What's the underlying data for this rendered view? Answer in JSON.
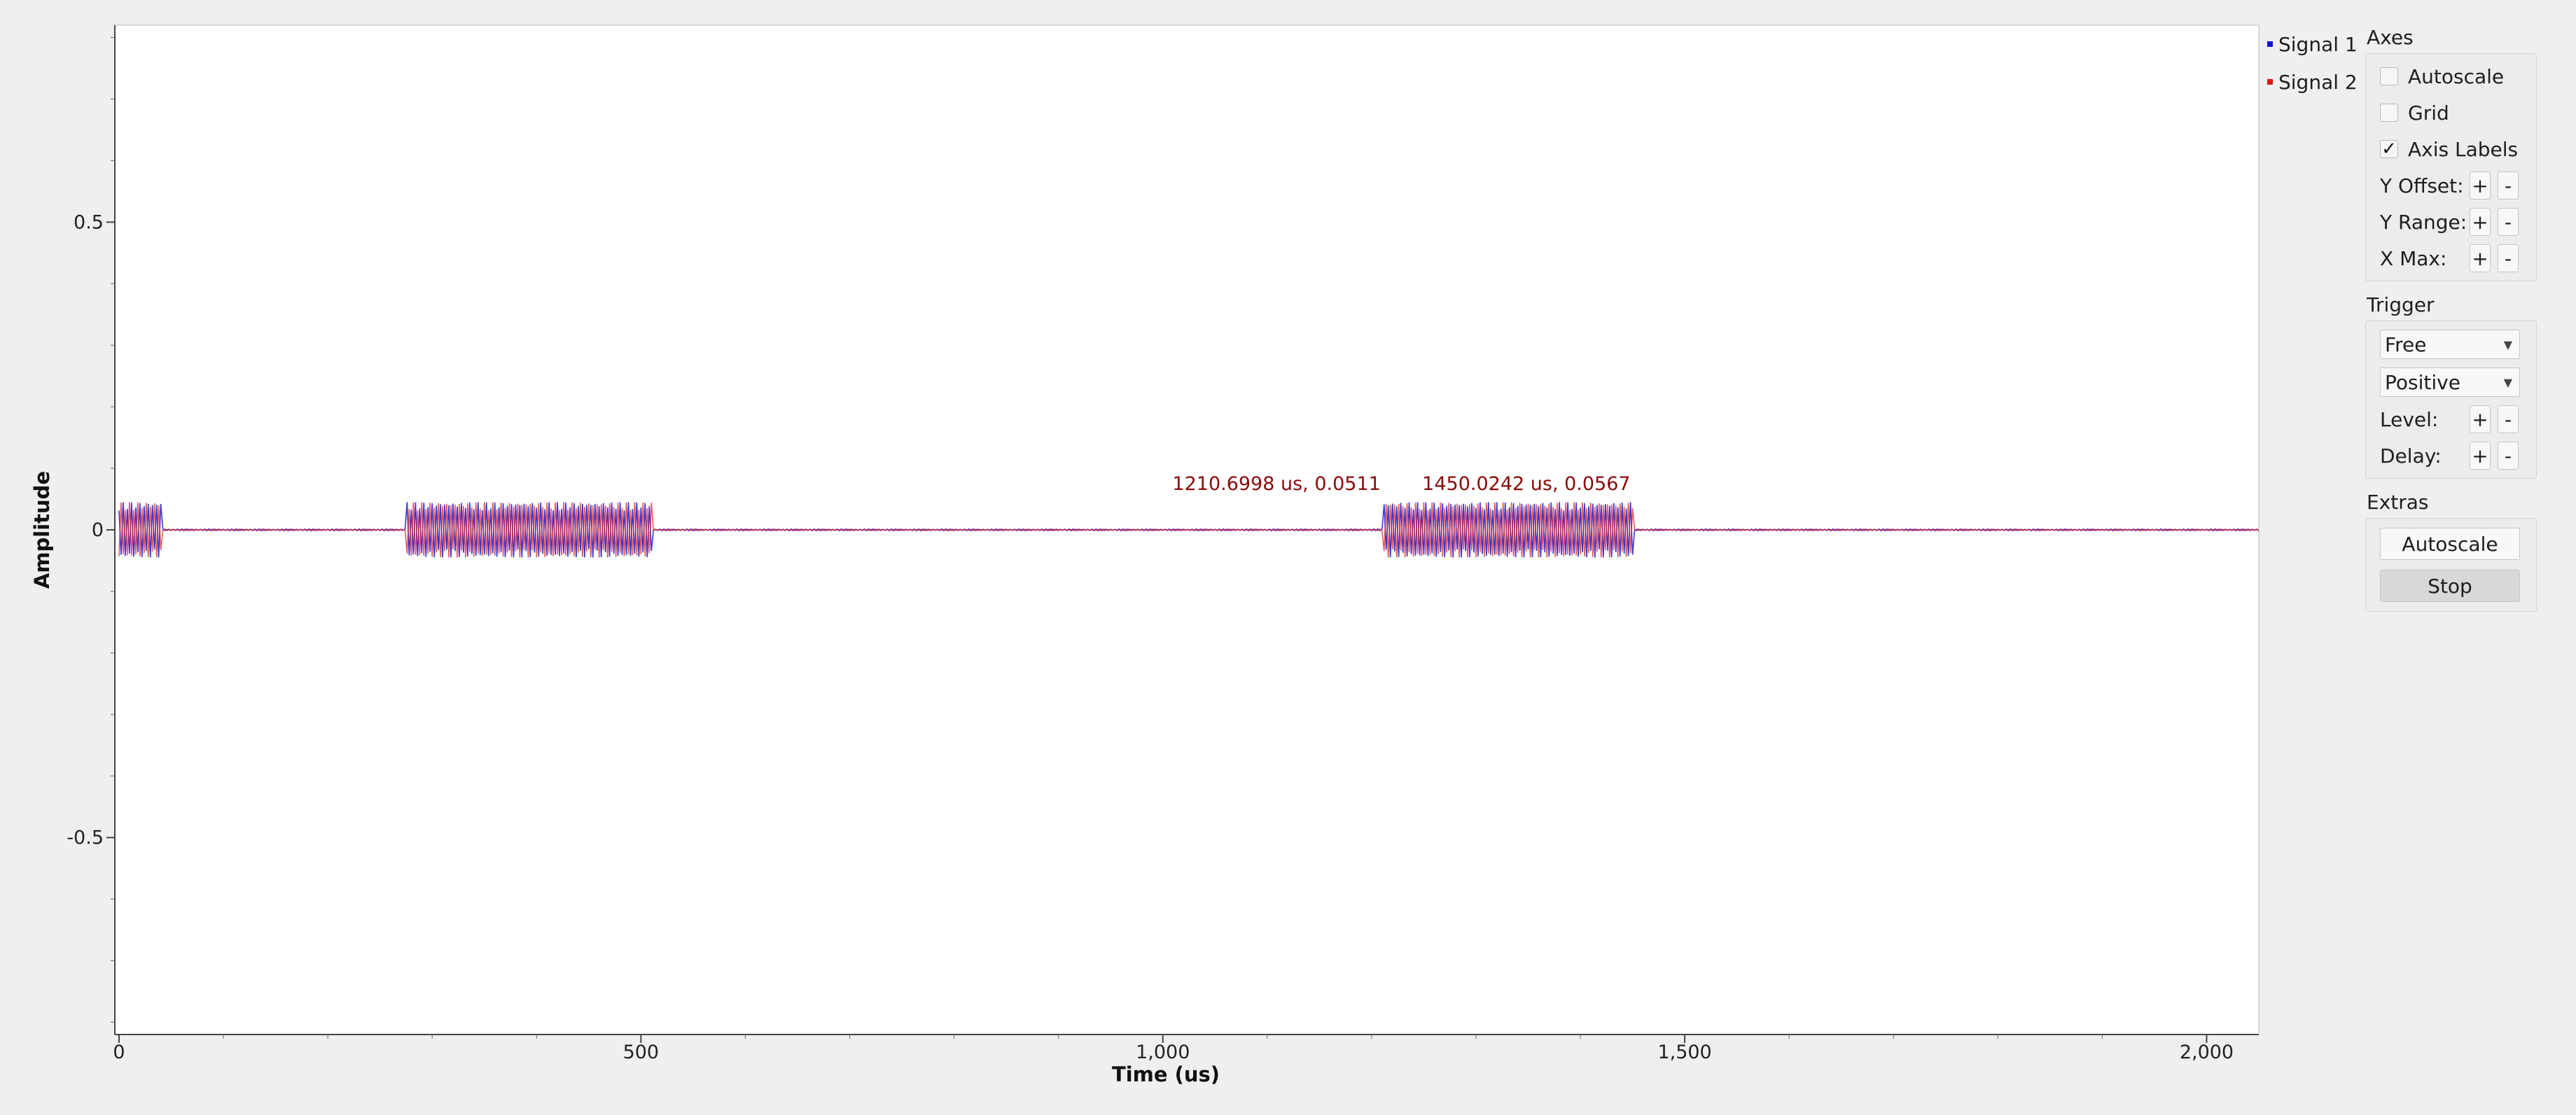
{
  "chart_data": {
    "type": "line",
    "xlabel": "Time (us)",
    "ylabel": "Amplitude",
    "xlim": [
      0,
      2050
    ],
    "ylim": [
      -0.82,
      0.82
    ],
    "x_ticks": [
      {
        "value": 0,
        "label": "0"
      },
      {
        "value": 500,
        "label": "500"
      },
      {
        "value": 1000,
        "label": "1,000"
      },
      {
        "value": 1500,
        "label": "1,500"
      },
      {
        "value": 2000,
        "label": "2,000"
      }
    ],
    "y_ticks": [
      {
        "value": 0.5,
        "label": "0.5"
      },
      {
        "value": 0,
        "label": "0"
      },
      {
        "value": -0.5,
        "label": "-0.5"
      }
    ],
    "bursts_us": [
      [
        0,
        40
      ],
      [
        275,
        510
      ],
      [
        1212,
        1450
      ]
    ],
    "burst_amplitude": 0.045,
    "series": [
      {
        "name": "Signal 1",
        "color": "#1414d2"
      },
      {
        "name": "Signal 2",
        "color": "#e01414"
      }
    ],
    "markers": [
      {
        "x": 1210.6998,
        "y": 0.0511,
        "label": "1210.6998 us, 0.0511"
      },
      {
        "x": 1450.0242,
        "y": 0.0567,
        "label": "1450.0242 us, 0.0567"
      }
    ],
    "grid": false
  },
  "legend": {
    "signal1": {
      "label": "Signal 1",
      "color": "#1414d2"
    },
    "signal2": {
      "label": "Signal 2",
      "color": "#e01414"
    }
  },
  "axes": {
    "title": "Axes",
    "autoscale": {
      "label": "Autoscale",
      "checked": false,
      "mark": ""
    },
    "grid": {
      "label": "Grid",
      "checked": false,
      "mark": ""
    },
    "axis_labels": {
      "label": "Axis Labels",
      "checked": true,
      "mark": "✓"
    },
    "y_offset": "Y Offset:",
    "y_range": "Y Range:",
    "x_max": "X Max:",
    "plus": "+",
    "minus": "-"
  },
  "trigger": {
    "title": "Trigger",
    "mode": "Free",
    "slope": "Positive",
    "level": "Level:",
    "delay": "Delay:"
  },
  "extras": {
    "title": "Extras",
    "autoscale_button": "Autoscale",
    "stop_button": "Stop"
  }
}
